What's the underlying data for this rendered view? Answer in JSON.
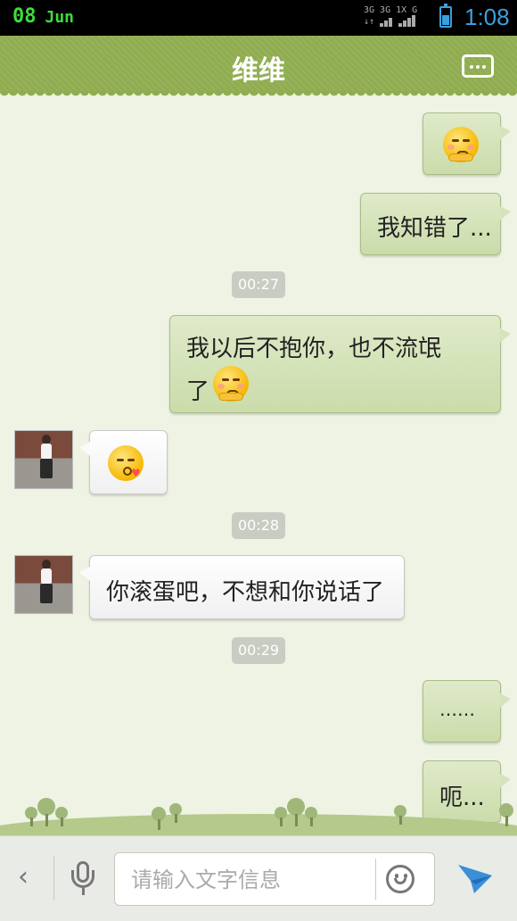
{
  "status_bar": {
    "day": "08",
    "month": "Jun",
    "network_top": "3G 3G 1X G",
    "time": "1:08",
    "battery_level": 0.6,
    "date_color": "#3ddc3d",
    "time_color": "#3aa0dc"
  },
  "header": {
    "title": "维维",
    "menu_icon": "more-dots-icon",
    "color": "#8fad50"
  },
  "messages": [
    {
      "side": "out",
      "kind": "emoji",
      "emoji": "embarrassed-face"
    },
    {
      "side": "out",
      "kind": "text",
      "text": "我知错了..."
    },
    {
      "kind": "timestamp",
      "text": "00:27"
    },
    {
      "side": "out",
      "kind": "text",
      "line1": "我以后不抱你，也不流氓",
      "line2": "了",
      "emoji": "embarrassed-face"
    },
    {
      "side": "in",
      "kind": "emoji",
      "emoji": "kiss-face"
    },
    {
      "kind": "timestamp",
      "text": "00:28"
    },
    {
      "side": "in",
      "kind": "text",
      "text": "你滚蛋吧，不想和你说话了"
    },
    {
      "kind": "timestamp",
      "text": "00:29"
    },
    {
      "side": "out",
      "kind": "text",
      "text": "……"
    },
    {
      "side": "out",
      "kind": "text",
      "text": "呃..."
    }
  ],
  "input_bar": {
    "back_icon": "chevron-left-icon",
    "voice_icon": "microphone-icon",
    "placeholder": "请输入文字信息",
    "emoji_icon": "smiley-icon",
    "send_icon": "send-plane-icon",
    "send_color": "#3a8fd6"
  }
}
